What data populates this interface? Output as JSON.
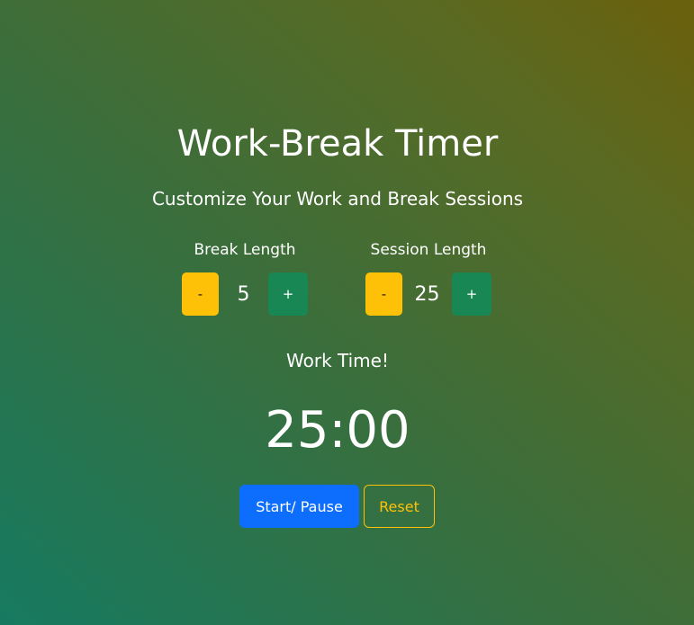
{
  "header": {
    "title": "Work-Break Timer",
    "subtitle": "Customize Your Work and Break Sessions"
  },
  "break_control": {
    "label": "Break Length",
    "decrement_label": "-",
    "value": "5",
    "increment_label": "+"
  },
  "session_control": {
    "label": "Session Length",
    "decrement_label": "-",
    "value": "25",
    "increment_label": "+"
  },
  "timer": {
    "mode_label": "Work Time!",
    "time": "25:00"
  },
  "actions": {
    "start_pause_label": "Start/ Pause",
    "reset_label": "Reset"
  },
  "colors": {
    "minus_button": "#ffc107",
    "plus_button": "#198754",
    "start_button": "#0d6efd",
    "reset_outline": "#ffc107"
  }
}
